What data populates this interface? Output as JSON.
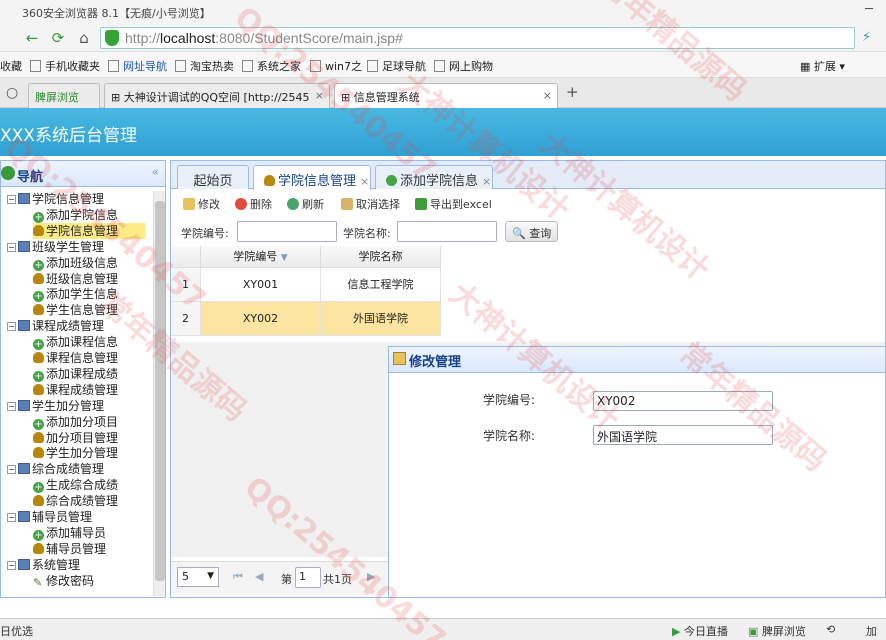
{
  "browser": {
    "title": "360安全浏览器 8.1【无痕/小号浏览】",
    "url_prefix": "http://",
    "url_host": "localhost",
    "url_rest": ":8080/StudentScore/main.jsp#",
    "extensions_label": "扩展",
    "bookmarks": [
      "收藏",
      "手机收藏夹",
      "网址导航",
      "淘宝热卖",
      "系统之家",
      "win7之",
      "足球导航",
      "网上购物"
    ],
    "tabs": [
      {
        "label": "脾屏浏览"
      },
      {
        "label": "大神设计调试的QQ空间 [http://2545"
      },
      {
        "label": "信息管理系统"
      }
    ],
    "new_tab": "+"
  },
  "app": {
    "title": "XXX系统后台管理"
  },
  "nav": {
    "title": "导航",
    "collapse": "«",
    "tree": [
      {
        "label": "学院信息管理",
        "kind": "folder"
      },
      {
        "label": "添加学院信息",
        "kind": "add"
      },
      {
        "label": "学院信息管理",
        "kind": "user",
        "selected": true
      },
      {
        "label": "班级学生管理",
        "kind": "folder"
      },
      {
        "label": "添加班级信息",
        "kind": "add"
      },
      {
        "label": "班级信息管理",
        "kind": "user"
      },
      {
        "label": "添加学生信息",
        "kind": "add"
      },
      {
        "label": "学生信息管理",
        "kind": "user"
      },
      {
        "label": "课程成绩管理",
        "kind": "folder"
      },
      {
        "label": "添加课程信息",
        "kind": "add"
      },
      {
        "label": "课程信息管理",
        "kind": "user"
      },
      {
        "label": "添加课程成绩",
        "kind": "add"
      },
      {
        "label": "课程成绩管理",
        "kind": "user"
      },
      {
        "label": "学生加分管理",
        "kind": "folder"
      },
      {
        "label": "添加加分项目",
        "kind": "add"
      },
      {
        "label": "加分项目管理",
        "kind": "user"
      },
      {
        "label": "学生加分管理",
        "kind": "user"
      },
      {
        "label": "综合成绩管理",
        "kind": "folder"
      },
      {
        "label": "生成综合成绩",
        "kind": "add"
      },
      {
        "label": "综合成绩管理",
        "kind": "user"
      },
      {
        "label": "辅导员管理",
        "kind": "folder"
      },
      {
        "label": "添加辅导员",
        "kind": "add"
      },
      {
        "label": "辅导员管理",
        "kind": "user"
      },
      {
        "label": "系统管理",
        "kind": "folder"
      },
      {
        "label": "修改密码",
        "kind": "pencil"
      }
    ]
  },
  "main": {
    "tabs": [
      {
        "label": "起始页",
        "active": false,
        "closable": false
      },
      {
        "label": "学院信息管理",
        "active": true,
        "closable": true
      },
      {
        "label": "添加学院信息",
        "active": false,
        "closable": true
      }
    ],
    "toolbar": {
      "edit": "修改",
      "delete": "删除",
      "refresh": "刷新",
      "cancel_select": "取消选择",
      "export": "导出到excel"
    },
    "search": {
      "code_label": "学院编号:",
      "name_label": "学院名称:",
      "query": "查询"
    },
    "grid": {
      "columns": [
        "学院编号",
        "学院名称"
      ],
      "rows": [
        {
          "num": "1",
          "code": "XY001",
          "name": "信息工程学院"
        },
        {
          "num": "2",
          "code": "XY002",
          "name": "外国语学院"
        }
      ]
    },
    "pager": {
      "page_size": "5",
      "page_prefix": "第",
      "page_value": "1",
      "page_suffix": "共1页"
    }
  },
  "dialog": {
    "title": "修改管理",
    "code_label": "学院编号:",
    "code_value": "XY002",
    "name_label": "学院名称:",
    "name_value": "外国语学院"
  },
  "statusbar": {
    "left": "日优选",
    "live": "今日直播",
    "browse": "脾屏浏览",
    "plus": "加"
  },
  "watermarks": [
    "QQ:254540457",
    "大神计算机设计",
    "常年精品源码",
    "QQ:254540457",
    "大神计算机设计",
    "常年精品源码",
    "QQ:254540457",
    "大神计算机设计",
    "常年精品源码"
  ]
}
